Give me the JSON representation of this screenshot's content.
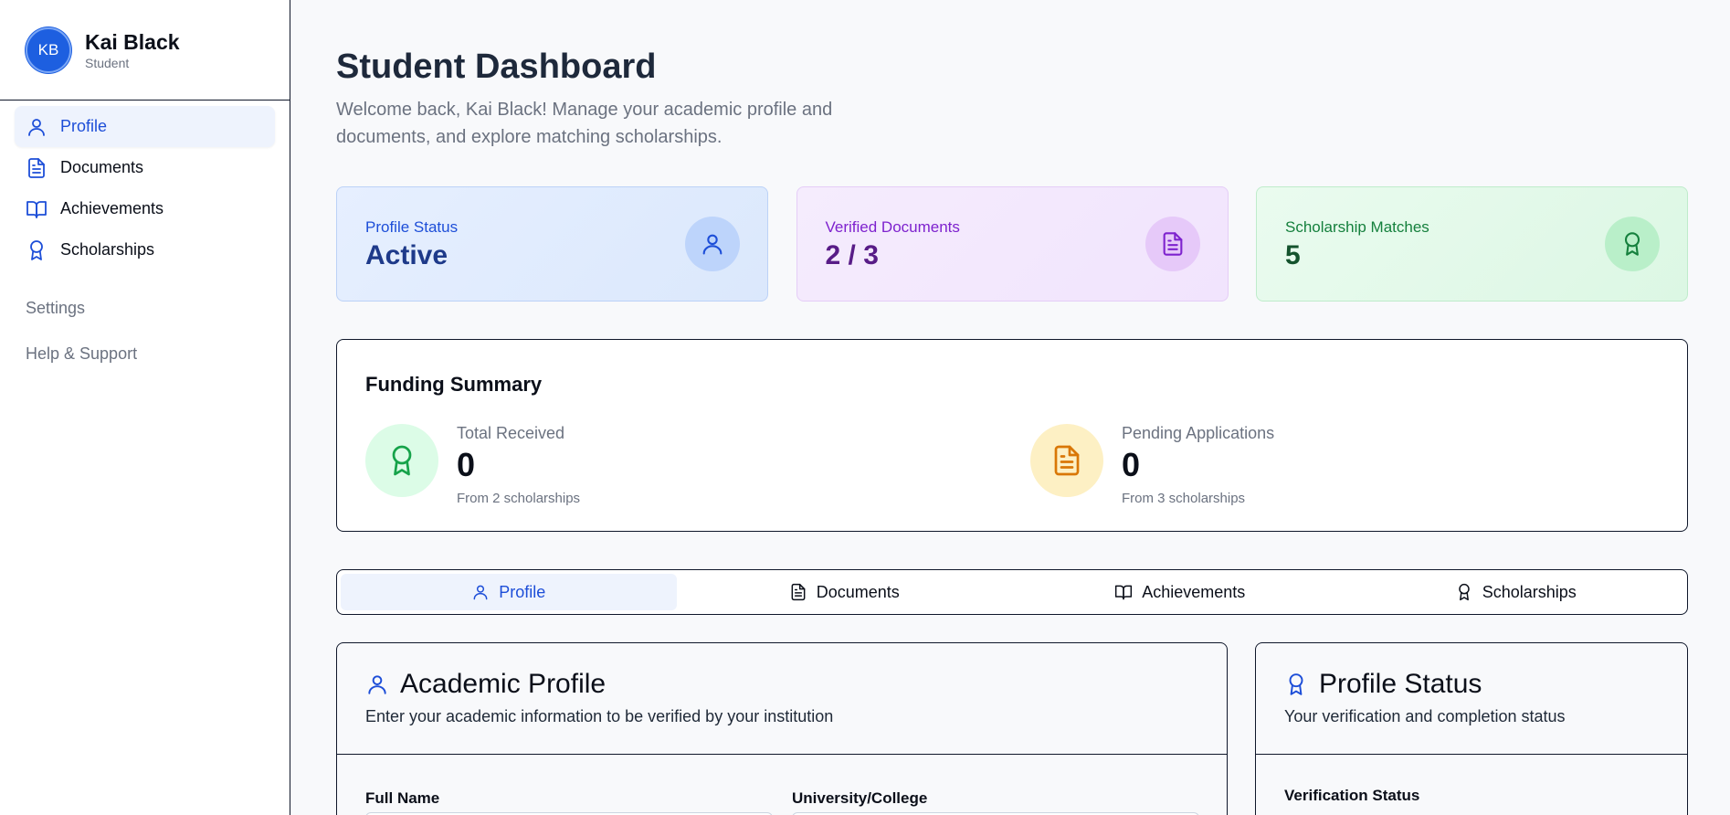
{
  "user": {
    "initials": "KB",
    "name": "Kai Black",
    "role": "Student"
  },
  "sidebar": {
    "items": [
      {
        "label": "Profile",
        "icon": "user-icon",
        "active": true
      },
      {
        "label": "Documents",
        "icon": "file-text-icon"
      },
      {
        "label": "Achievements",
        "icon": "book-open-icon"
      },
      {
        "label": "Scholarships",
        "icon": "award-icon"
      }
    ],
    "secondary": [
      "Settings",
      "Help & Support"
    ]
  },
  "header": {
    "title": "Student Dashboard",
    "subtitle": "Welcome back, Kai Black! Manage your academic profile and documents, and explore matching scholarships."
  },
  "stats": [
    {
      "label": "Profile Status",
      "value": "Active",
      "icon": "user-icon",
      "color": "#1d4ed8"
    },
    {
      "label": "Verified Documents",
      "value": "2 / 3",
      "icon": "file-text-icon",
      "color": "#7e22ce"
    },
    {
      "label": "Scholarship Matches",
      "value": "5",
      "icon": "award-icon",
      "color": "#15803d"
    }
  ],
  "funding": {
    "title": "Funding Summary",
    "total": {
      "label": "Total Received",
      "value": "0",
      "note": "From 2 scholarships",
      "icon": "award-icon",
      "color": "#16a34a"
    },
    "pending": {
      "label": "Pending Applications",
      "value": "0",
      "note": "From 3 scholarships",
      "icon": "file-text-icon",
      "color": "#d97706"
    }
  },
  "tabs": [
    {
      "label": "Profile",
      "icon": "user-icon",
      "active": true
    },
    {
      "label": "Documents",
      "icon": "file-text-icon"
    },
    {
      "label": "Achievements",
      "icon": "book-open-icon"
    },
    {
      "label": "Scholarships",
      "icon": "award-icon"
    }
  ],
  "academic_profile": {
    "title": "Academic Profile",
    "description": "Enter your academic information to be verified by your institution",
    "fields": {
      "full_name": "Full Name",
      "university": "University/College"
    }
  },
  "profile_status": {
    "title": "Profile Status",
    "description": "Your verification and completion status",
    "verification_label": "Verification Status"
  }
}
